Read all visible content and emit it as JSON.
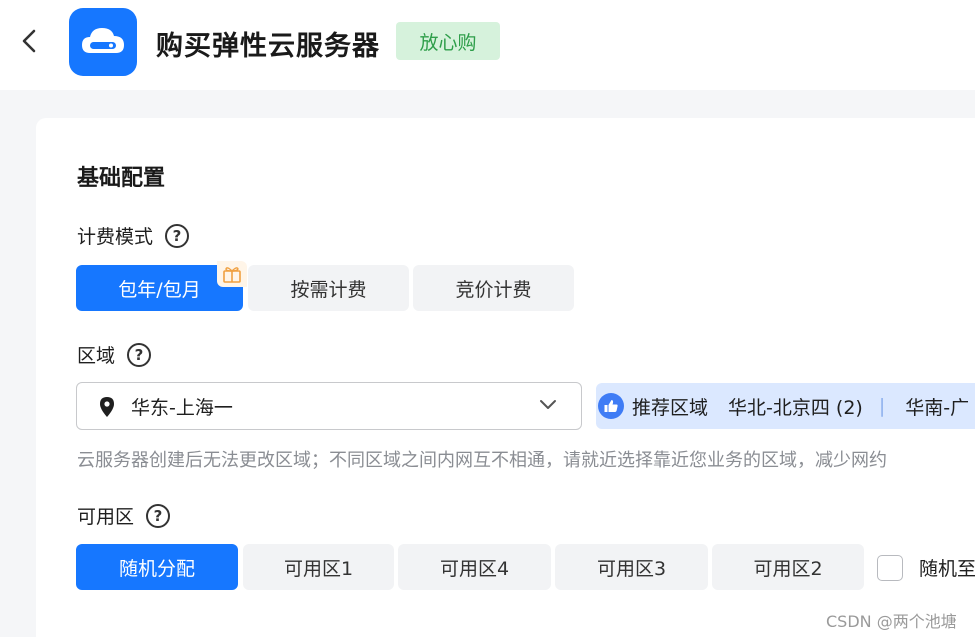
{
  "header": {
    "back_icon": "chevron-left-icon",
    "logo_icon": "cloud-server-icon",
    "title": "购买弹性云服务器",
    "badge": "放心购",
    "brand_color": "#1677ff"
  },
  "basic_config": {
    "section_title": "基础配置",
    "billing": {
      "label": "计费模式",
      "help_icon": "question-icon",
      "options": [
        {
          "label": "包年/包月",
          "selected": true,
          "icon": "gift-icon"
        },
        {
          "label": "按需计费",
          "selected": false
        },
        {
          "label": "竞价计费",
          "selected": false
        }
      ]
    },
    "region": {
      "label": "区域",
      "help_icon": "question-icon",
      "selected_value": "华东-上海一",
      "recommend_label": "推荐区域",
      "recommend_items": [
        "华北-北京四 (2)",
        "华南-广"
      ],
      "hint": "云服务器创建后无法更改区域；不同区域之间内网互不相通，请就近选择靠近您业务的区域，减少网约"
    },
    "az": {
      "label": "可用区",
      "help_icon": "question-icon",
      "options": [
        {
          "label": "随机分配",
          "selected": true
        },
        {
          "label": "可用区1",
          "selected": false
        },
        {
          "label": "可用区4",
          "selected": false
        },
        {
          "label": "可用区3",
          "selected": false
        },
        {
          "label": "可用区2",
          "selected": false
        }
      ],
      "checkbox_label": "随机至"
    }
  },
  "watermark": "CSDN @两个池塘"
}
